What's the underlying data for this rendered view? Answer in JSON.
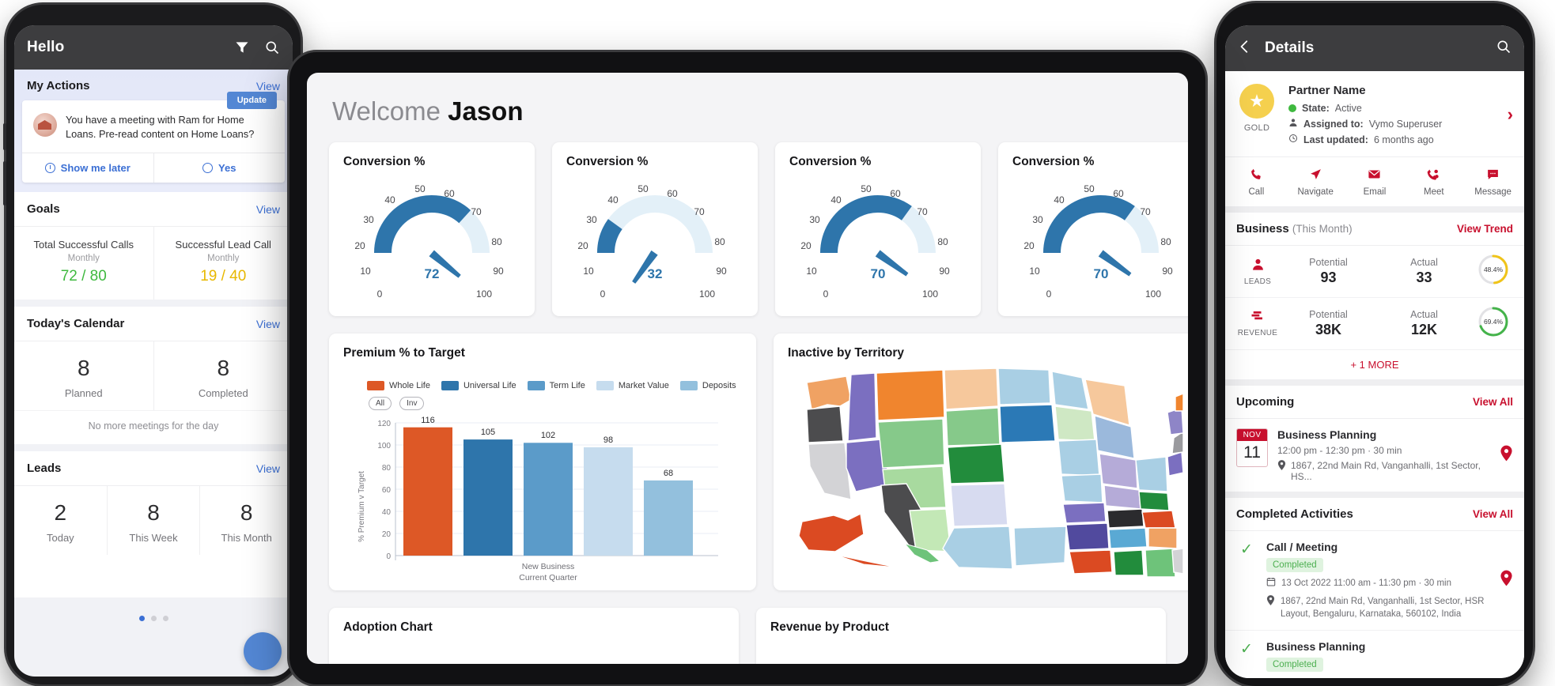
{
  "left_phone": {
    "appbar": {
      "title": "Hello",
      "filter_icon": "filter-icon",
      "search_icon": "search-icon"
    },
    "my_actions": {
      "title": "My Actions",
      "view_link": "View",
      "update_button": "Update",
      "message": "You have a meeting with Ram for Home Loans. Pre-read content on Home Loans?",
      "action_later": "Show me later",
      "action_yes": "Yes"
    },
    "goals": {
      "title": "Goals",
      "view_link": "View",
      "items": [
        {
          "label": "Total Successful Calls",
          "period": "Monthly",
          "value": "72 / 80",
          "tone": "green"
        },
        {
          "label": "Successful Lead Call",
          "period": "Monthly",
          "value": "19 / 40",
          "tone": "amber"
        }
      ]
    },
    "calendar": {
      "title": "Today's Calendar",
      "view_link": "View",
      "counts": [
        {
          "number": "8",
          "caption": "Planned"
        },
        {
          "number": "8",
          "caption": "Completed"
        }
      ],
      "note": "No more meetings for the day"
    },
    "leads": {
      "title": "Leads",
      "view_link": "View",
      "counts": [
        {
          "number": "2",
          "caption": "Today"
        },
        {
          "number": "8",
          "caption": "This Week"
        },
        {
          "number": "8",
          "caption": "This Month"
        }
      ]
    },
    "pager": {
      "active_index": 0,
      "total": 3
    }
  },
  "tablet": {
    "greeting_prefix": "Welcome",
    "greeting_name": "Jason",
    "gauge_cards": [
      {
        "title": "Conversion %",
        "value": 72
      },
      {
        "title": "Conversion %",
        "value": 32
      },
      {
        "title": "Conversion %",
        "value": 70
      },
      {
        "title": "Conversion %",
        "value": 70
      }
    ],
    "premium_card_title": "Premium %  to Target",
    "map_card_title": "Inactive by Territory",
    "bottom_cards": [
      {
        "title": "Adoption Chart"
      },
      {
        "title": "Revenue by Product"
      }
    ]
  },
  "chart_data": [
    {
      "type": "bar",
      "title": "Premium %  to Target",
      "categories": [
        "Whole Life",
        "Universal Life",
        "Term Life",
        "Market Value",
        "Deposits"
      ],
      "values": [
        116,
        105,
        102,
        98,
        68
      ],
      "colors": [
        "#dd5826",
        "#2e75ab",
        "#5b9bc9",
        "#c6dcee",
        "#93c0dd"
      ],
      "legend": [
        "Whole Life",
        "Universal Life",
        "Term Life",
        "Market Value",
        "Deposits"
      ],
      "legend_position": "top",
      "filter_pills": [
        "All",
        "Inv"
      ],
      "xlabel": "New Business",
      "xsublabel": "Current Quarter",
      "ylabel": "% Premium v Target",
      "yticks": [
        0,
        20,
        40,
        60,
        80,
        100,
        120
      ],
      "ylim": [
        0,
        126
      ],
      "grid": true
    },
    {
      "type": "gauge",
      "title": "Conversion %",
      "values": [
        72,
        32,
        70,
        70
      ],
      "ticks": [
        0,
        10,
        20,
        30,
        40,
        50,
        60,
        70,
        80,
        90,
        100
      ],
      "min": 0,
      "max": 100,
      "arc_color": "#2e75ab",
      "track_color": "#e3f0f8"
    },
    {
      "type": "heatmap",
      "title": "Inactive by Territory",
      "subtype": "choropleth-us-states",
      "note": "US state map, each state filled with a categorical color"
    }
  ],
  "right_phone": {
    "appbar": {
      "back_icon": "chevron-left-icon",
      "title": "Details",
      "search_icon": "search-icon"
    },
    "partner": {
      "tier_label": "GOLD",
      "name": "Partner Name",
      "state_key": "State:",
      "state_value": "Active",
      "assigned_key": "Assigned to:",
      "assigned_value": "Vymo Superuser",
      "updated_key": "Last updated:",
      "updated_value": "6 months ago"
    },
    "quick_actions": [
      {
        "icon": "phone-icon",
        "label": "Call"
      },
      {
        "icon": "navigate-icon",
        "label": "Navigate"
      },
      {
        "icon": "email-icon",
        "label": "Email"
      },
      {
        "icon": "meet-icon",
        "label": "Meet"
      },
      {
        "icon": "message-icon",
        "label": "Message"
      }
    ],
    "business": {
      "title": "Business",
      "title_suffix": "(This Month)",
      "view_trend": "View Trend",
      "rows": [
        {
          "icon": "person-icon",
          "icon_label": "LEADS",
          "potential_key": "Potential",
          "potential": "93",
          "actual_key": "Actual",
          "actual": "33",
          "percent": "48.4%",
          "ring_color": "#f0c419"
        },
        {
          "icon": "money-icon",
          "icon_label": "REVENUE",
          "potential_key": "Potential",
          "potential": "38K",
          "actual_key": "Actual",
          "actual": "12K",
          "percent": "69.4%",
          "ring_color": "#44b34a"
        }
      ],
      "more_label": "+ 1 MORE"
    },
    "upcoming": {
      "title": "Upcoming",
      "view_all": "View All",
      "item": {
        "month": "NOV",
        "day": "11",
        "title": "Business Planning",
        "time": "12:00 pm - 12:30 pm  ·  30 min",
        "address": "1867, 22nd Main Rd, Vanganhalli, 1st Sector, HS..."
      }
    },
    "completed": {
      "title": "Completed Activities",
      "view_all": "View All",
      "items": [
        {
          "title": "Call / Meeting",
          "status": "Completed",
          "time": "13 Oct 2022  11:00 am - 11:30 pm  ·  30 min",
          "address": "1867, 22nd Main Rd, Vanganhalli, 1st Sector, HSR Layout, Bengaluru, Karnataka, 560102, India"
        },
        {
          "title": "Business Planning",
          "status": "Completed",
          "time": "",
          "address": ""
        }
      ]
    }
  },
  "colors": {
    "appbar": "#3d3d3f",
    "accent_blue": "#3b6fd4",
    "accent_red": "#c8102e",
    "green": "#4caf50",
    "amber": "#e8b800",
    "orange": "#dd5826"
  }
}
